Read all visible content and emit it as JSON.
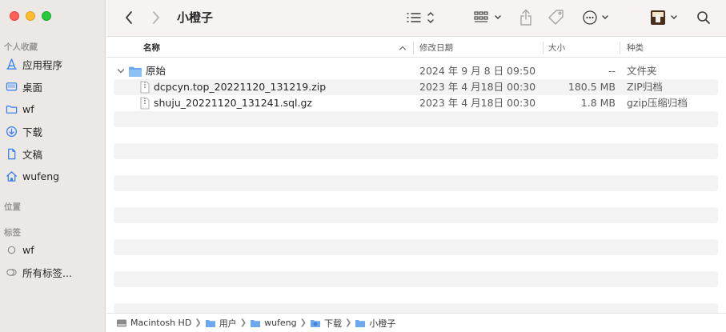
{
  "sidebar": {
    "favorites_label": "个人收藏",
    "locations_label": "位置",
    "tags_label": "标签",
    "favorites": [
      {
        "label": "应用程序",
        "icon": "applications-icon"
      },
      {
        "label": "桌面",
        "icon": "desktop-icon"
      },
      {
        "label": "wf",
        "icon": "folder-icon"
      },
      {
        "label": "下载",
        "icon": "downloads-icon"
      },
      {
        "label": "文稿",
        "icon": "document-icon"
      },
      {
        "label": "wufeng",
        "icon": "home-icon"
      }
    ],
    "tags": [
      {
        "label": "wf",
        "icon": "tag-circle-icon"
      },
      {
        "label": "所有标签...",
        "icon": "all-tags-icon"
      }
    ]
  },
  "toolbar": {
    "title": "小橙子"
  },
  "columns": {
    "name": "名称",
    "date": "修改日期",
    "size": "大小",
    "kind": "种类"
  },
  "files": [
    {
      "name": "原始",
      "date": "2024 年 9 月 8 日 09:50",
      "size": "--",
      "kind": "文件夹",
      "type": "folder"
    },
    {
      "name": "dcpcyn.top_20221120_131219.zip",
      "date": "2023 年 4 月18日 00:30",
      "size": "180.5 MB",
      "kind": "ZIP归档",
      "type": "file"
    },
    {
      "name": "shuju_20221120_131241.sql.gz",
      "date": "2023 年 4 月18日 00:30",
      "size": "1.8 MB",
      "kind": "gzip压缩归档",
      "type": "file"
    }
  ],
  "pathbar": [
    {
      "label": "Macintosh HD",
      "icon": "hard-drive-icon"
    },
    {
      "label": "用户",
      "icon": "folder-icon"
    },
    {
      "label": "wufeng",
      "icon": "folder-icon"
    },
    {
      "label": "下载",
      "icon": "downloads-folder-icon"
    },
    {
      "label": "小橙子",
      "icon": "folder-icon"
    }
  ],
  "colors": {
    "accent": "#2f7cf6",
    "folder": "#6aa9f0"
  }
}
